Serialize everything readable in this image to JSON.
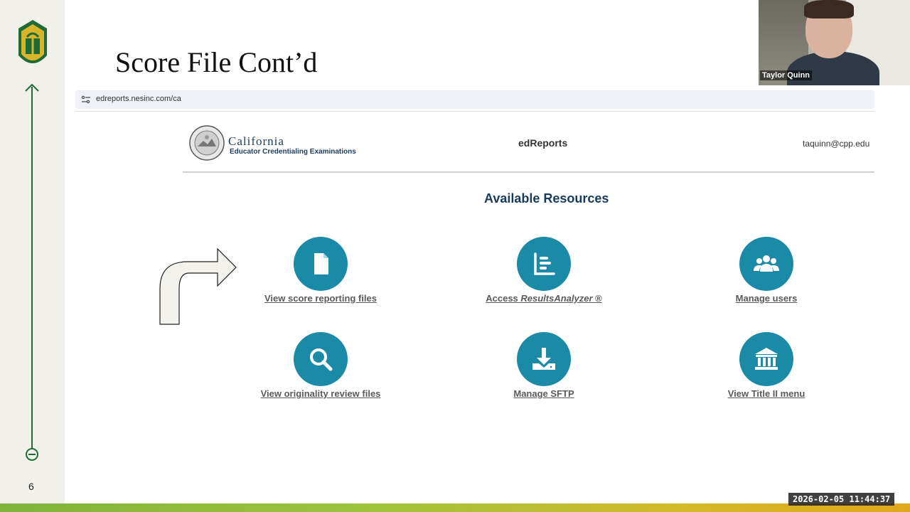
{
  "slide": {
    "title": "Score File Cont’d",
    "page_number": "6"
  },
  "browser": {
    "url": "edreports.nesinc.com/ca"
  },
  "site_header": {
    "brand_main": "California",
    "brand_sub": "Educator Credentialing Examinations",
    "app_name": "edReports",
    "user_email": "taquinn@cpp.edu"
  },
  "resources": {
    "heading": "Available Resources",
    "items": [
      {
        "label": "View score reporting files",
        "icon": "file-icon"
      },
      {
        "label_prefix": "Access ",
        "label_italic": "ResultsAnalyzer",
        "label_suffix": " ®",
        "icon": "bar-chart-icon"
      },
      {
        "label": "Manage users",
        "icon": "users-icon"
      },
      {
        "label": "View originality review files",
        "icon": "search-icon"
      },
      {
        "label": "Manage SFTP",
        "icon": "download-icon"
      },
      {
        "label": "View Title II menu",
        "icon": "institution-icon"
      }
    ]
  },
  "webcam": {
    "participant_name": "Taylor Quinn"
  },
  "recording": {
    "timestamp": "2026-02-05  11:44:37"
  },
  "colors": {
    "accent_teal": "#1a8aa7",
    "heading_navy": "#173a5e",
    "timeline_green": "#1f6b36"
  }
}
